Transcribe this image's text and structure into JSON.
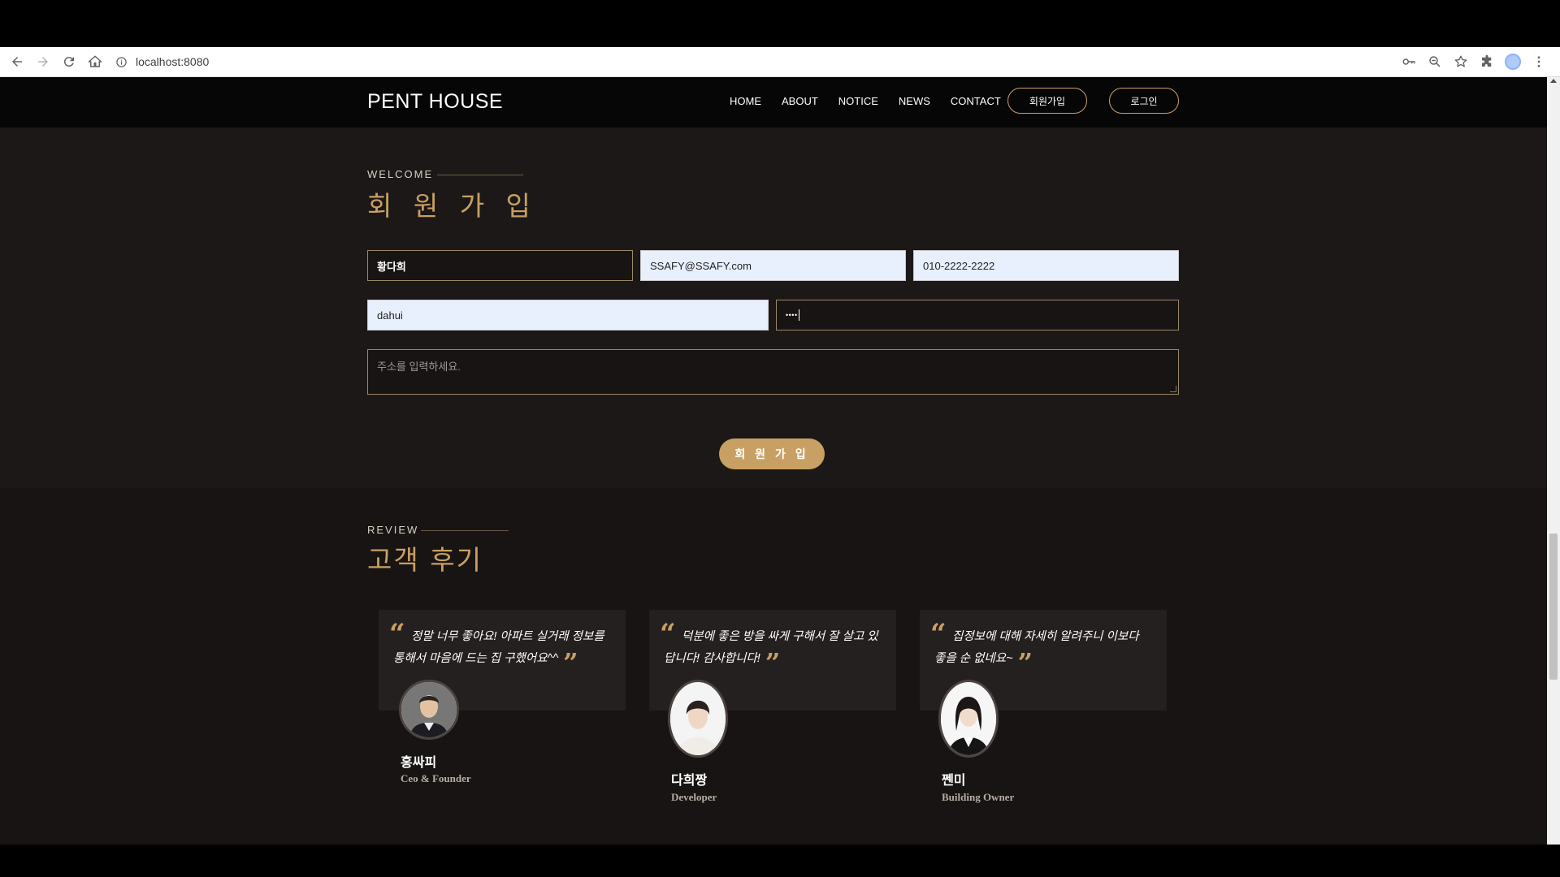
{
  "browser": {
    "url": "localhost:8080",
    "icons": [
      "back-icon",
      "forward-icon",
      "reload-icon",
      "home-icon",
      "info-icon",
      "key-icon",
      "zoom-icon",
      "star-icon",
      "extensions-icon",
      "profile-icon",
      "menu-icon"
    ]
  },
  "header": {
    "brand": "PENT HOUSE",
    "nav": [
      "HOME",
      "ABOUT",
      "NOTICE",
      "NEWS",
      "CONTACT"
    ],
    "signup_label": "회원가입",
    "login_label": "로그인"
  },
  "join": {
    "eyebrow": "WELCOME",
    "title": "회 원 가 입",
    "name_value": "황다희",
    "email_value": "SSAFY@SSAFY.com",
    "phone_value": "010-2222-2222",
    "id_value": "dahui",
    "password_value": "••••",
    "address_placeholder": "주소를 입력하세요.",
    "submit_label": "회 원 가 입"
  },
  "review": {
    "eyebrow": "REVIEW",
    "title": "고객 후기",
    "items": [
      {
        "quote": "정말 너무 좋아요! 아파트 실거래 정보를 통해서 마음에 드는 집 구했어요^^",
        "name": "홍싸피",
        "role": "Ceo & Founder"
      },
      {
        "quote": "덕분에 좋은 방을 싸게 구해서 잘 살고 있답니다! 감사합니다!",
        "name": "다희짱",
        "role": "Developer"
      },
      {
        "quote": "집정보에 대해 자세히 알려주니 이보다 좋을 순 없네요~",
        "name": "쩬미",
        "role": "Building Owner"
      }
    ]
  },
  "colors": {
    "accent": "#c9a063",
    "background": "#181414",
    "header_bg": "#060606"
  }
}
